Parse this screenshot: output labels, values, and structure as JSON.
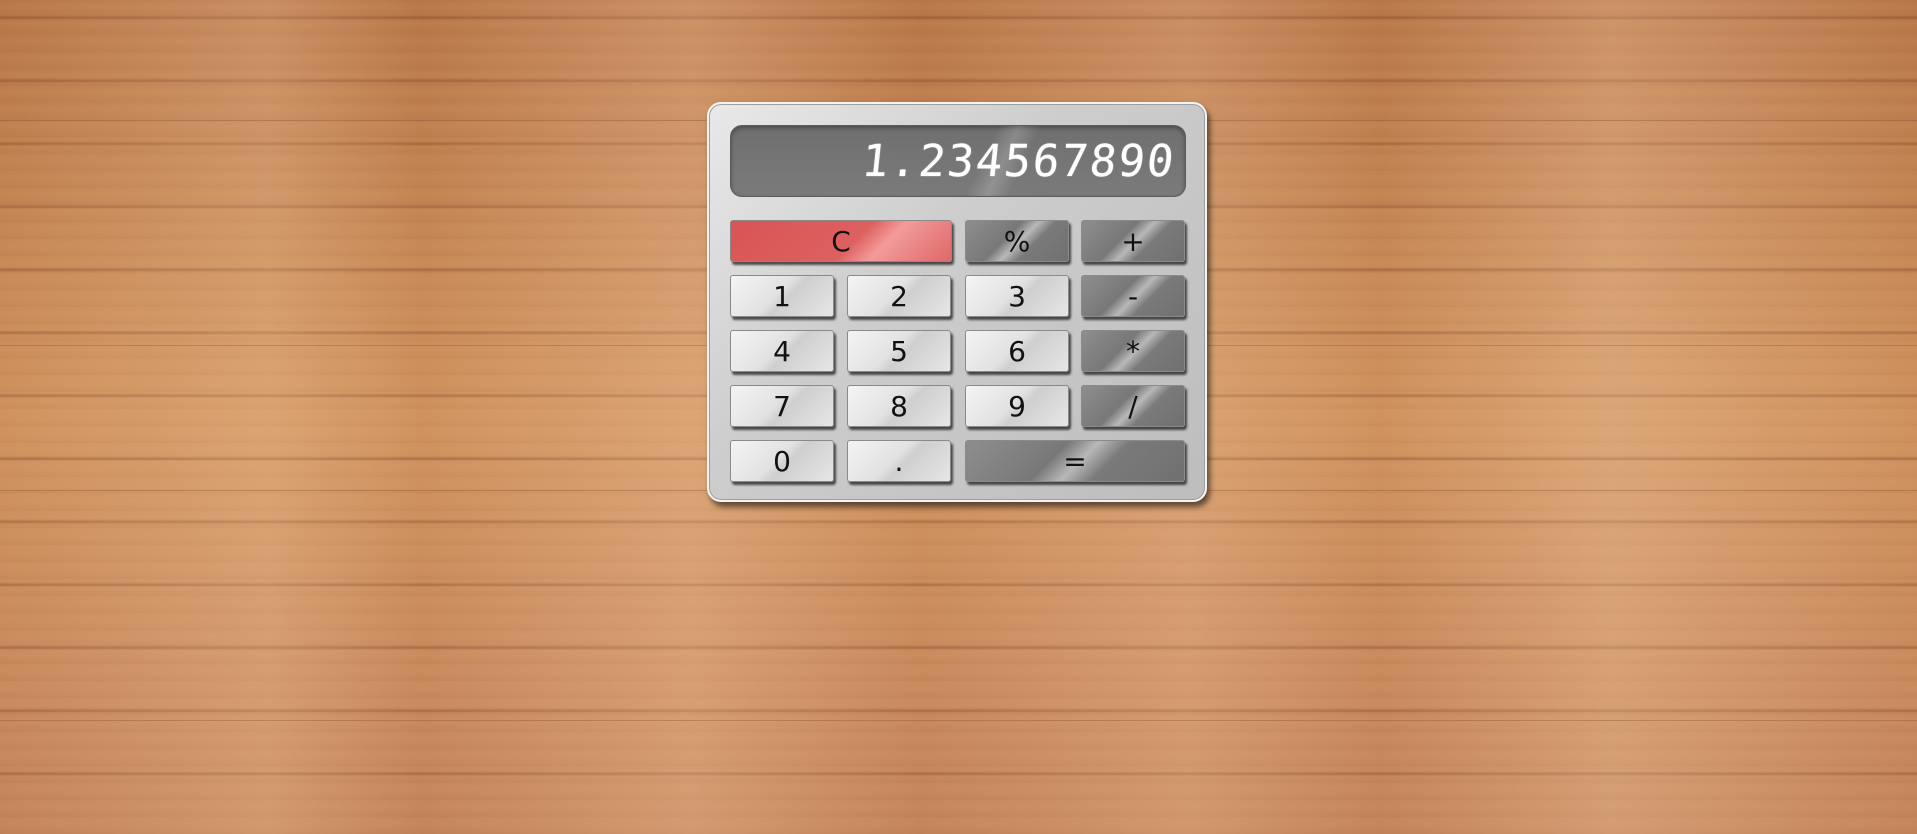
{
  "calculator": {
    "display": "1.234567890",
    "buttons": {
      "clear": "C",
      "percent": "%",
      "add": "+",
      "subtract": "-",
      "multiply": "*",
      "divide": "/",
      "equals": "=",
      "decimal": ".",
      "digits": [
        "0",
        "1",
        "2",
        "3",
        "4",
        "5",
        "6",
        "7",
        "8",
        "9"
      ]
    }
  },
  "colors": {
    "clear_key": "#dd5c5c",
    "operator_key": "#7a7a7a",
    "number_key": "#e6e6e6",
    "display_bg": "#737373",
    "display_text": "#ffffff",
    "wood": "#c98c5e"
  }
}
